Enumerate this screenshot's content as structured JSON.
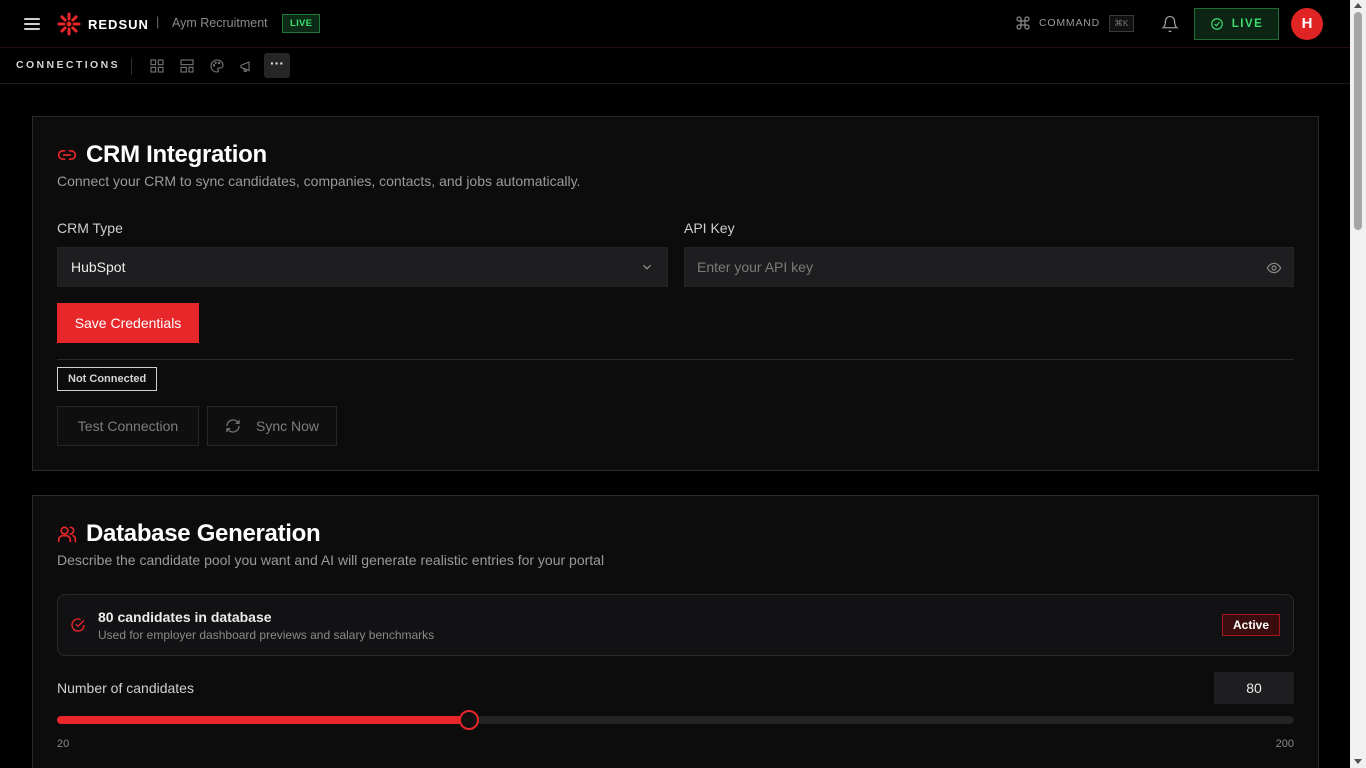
{
  "topbar": {
    "brand": "REDSUN",
    "separator": "|",
    "organization": "Aym Recruitment",
    "env_badge": "LIVE",
    "command_label": "COMMAND",
    "command_shortcut": "⌘K",
    "live_button_label": "LIVE",
    "avatar_initial": "H"
  },
  "subbar": {
    "title": "CONNECTIONS",
    "more_label": "···",
    "icons": [
      "grid-icon",
      "layout-icon",
      "palette-icon",
      "megaphone-icon"
    ]
  },
  "crm": {
    "title": "CRM Integration",
    "description": "Connect your CRM to sync candidates, companies, contacts, and jobs automatically.",
    "crm_type_label": "CRM Type",
    "crm_type_value": "HubSpot",
    "api_key_label": "API Key",
    "api_key_placeholder": "Enter your API key",
    "save_button": "Save Credentials",
    "status": "Not Connected",
    "test_button": "Test Connection",
    "sync_button": "Sync Now"
  },
  "database": {
    "title": "Database Generation",
    "description": "Describe the candidate pool you want and AI will generate realistic entries for your portal",
    "summary_title": "80 candidates in database",
    "summary_subtitle": "Used for employer dashboard previews and salary benchmarks",
    "status_badge": "Active",
    "count_label": "Number of candidates",
    "count_value": "80",
    "slider": {
      "min": 20,
      "max": 200,
      "value": 80,
      "min_label": "20",
      "max_label": "200"
    }
  },
  "colors": {
    "accent": "#e8272b",
    "live_green": "#3ddc6f",
    "background": "#000000",
    "card": "#0c0c0d"
  }
}
